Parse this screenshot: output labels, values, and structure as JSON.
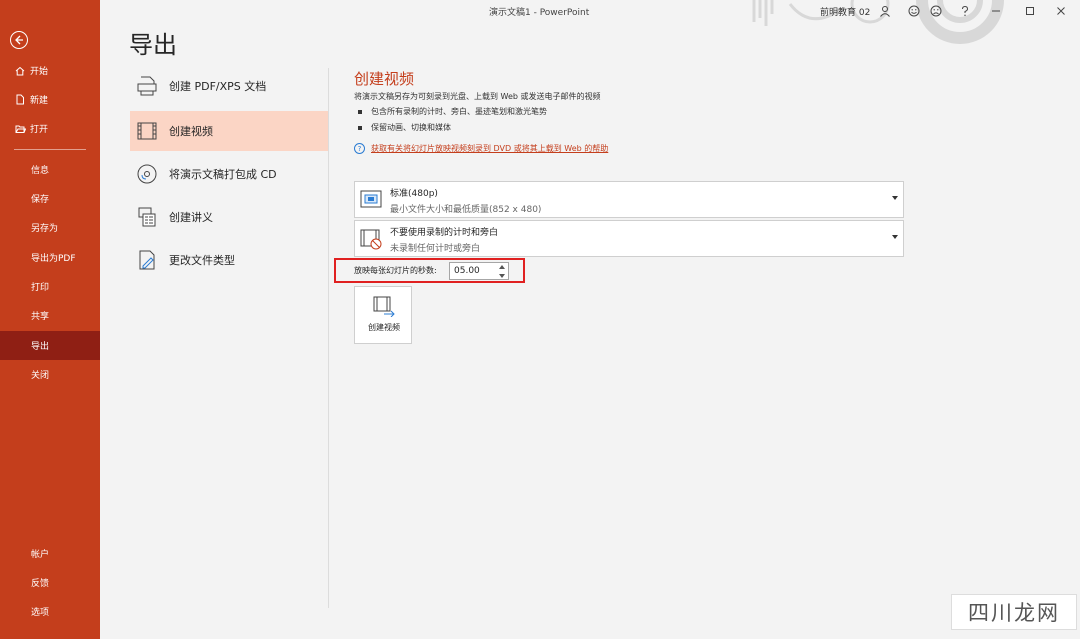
{
  "window": {
    "title": "演示文稿1  -  PowerPoint",
    "user": "前明教育 02"
  },
  "sidebar": {
    "items": [
      {
        "label": "开始",
        "icon": "home-icon"
      },
      {
        "label": "新建",
        "icon": "new-file-icon"
      },
      {
        "label": "打开",
        "icon": "folder-open-icon"
      },
      {
        "label": "信息"
      },
      {
        "label": "保存"
      },
      {
        "label": "另存为"
      },
      {
        "label": "导出为PDF"
      },
      {
        "label": "打印"
      },
      {
        "label": "共享"
      },
      {
        "label": "导出",
        "active": true
      },
      {
        "label": "关闭"
      }
    ],
    "bottom_items": [
      {
        "label": "帐户"
      },
      {
        "label": "反馈"
      },
      {
        "label": "选项"
      }
    ]
  },
  "page": {
    "title": "导出"
  },
  "export_options": [
    {
      "label": "创建 PDF/XPS 文档",
      "icon": "pdf-document-icon"
    },
    {
      "label": "创建视频",
      "icon": "video-film-icon",
      "selected": true
    },
    {
      "label": "将演示文稿打包成 CD",
      "icon": "cd-disc-icon"
    },
    {
      "label": "创建讲义",
      "icon": "handout-icon"
    },
    {
      "label": "更改文件类型",
      "icon": "change-file-type-icon"
    }
  ],
  "create_video": {
    "title": "创建视频",
    "description": "将演示文稿另存为可刻录到光盘、上载到 Web 或发送电子邮件的视频",
    "bullets": [
      "包含所有录制的计时、旁白、墨迹笔划和激光笔势",
      "保留动画、切换和媒体"
    ],
    "help_link": "获取有关将幻灯片放映视频刻录到 DVD 或将其上载到 Web 的帮助",
    "quality_dropdown": {
      "main": "标准(480p)",
      "sub": "最小文件大小和最低质量(852 x 480)"
    },
    "timing_dropdown": {
      "main": "不要使用录制的计时和旁白",
      "sub": "未录制任何计时或旁白"
    },
    "seconds_label": "放映每张幻灯片的秒数:",
    "seconds_value": "05.00",
    "create_button_label": "创建视频"
  },
  "watermark": "四川龙网",
  "colors": {
    "sidebar": "#c43e1c",
    "sidebar_active": "#8f1f14",
    "accent": "#c43e1c",
    "selected_option": "#fbd5c5",
    "highlight_box": "#e02020"
  }
}
